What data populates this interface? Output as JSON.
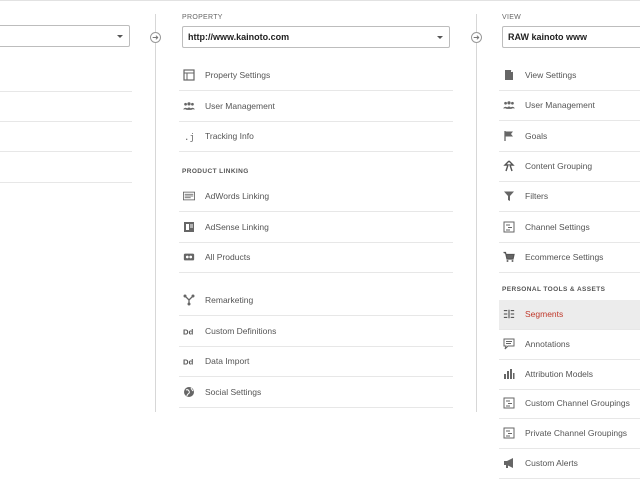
{
  "account": {
    "selected_value": ""
  },
  "property": {
    "label": "PROPERTY",
    "selected_value": "http://www.kainoto.com",
    "items": [
      {
        "label": "Property Settings",
        "icon": "property-settings-icon"
      },
      {
        "label": "User Management",
        "icon": "users-icon"
      },
      {
        "label": "Tracking Info",
        "icon": "js-icon"
      }
    ],
    "product_linking_label": "PRODUCT LINKING",
    "linking_items": [
      {
        "label": "AdWords Linking",
        "icon": "adwords-icon"
      },
      {
        "label": "AdSense Linking",
        "icon": "adsense-icon"
      },
      {
        "label": "All Products",
        "icon": "all-products-icon"
      }
    ],
    "other_items": [
      {
        "label": "Remarketing",
        "icon": "remarketing-icon"
      },
      {
        "label": "Custom Definitions",
        "icon": "dd-icon"
      },
      {
        "label": "Data Import",
        "icon": "dd-icon"
      },
      {
        "label": "Social Settings",
        "icon": "globe-icon"
      }
    ]
  },
  "view": {
    "label": "VIEW",
    "selected_value": "RAW kainoto www",
    "items": [
      {
        "label": "View Settings",
        "icon": "document-icon"
      },
      {
        "label": "User Management",
        "icon": "users-icon"
      },
      {
        "label": "Goals",
        "icon": "flag-icon"
      },
      {
        "label": "Content Grouping",
        "icon": "content-grouping-icon"
      },
      {
        "label": "Filters",
        "icon": "filter-icon"
      },
      {
        "label": "Channel Settings",
        "icon": "channel-icon"
      },
      {
        "label": "Ecommerce Settings",
        "icon": "cart-icon"
      }
    ],
    "personal_label": "PERSONAL TOOLS & ASSETS",
    "personal_items": [
      {
        "label": "Segments",
        "icon": "segments-icon",
        "active": true
      },
      {
        "label": "Annotations",
        "icon": "annotation-icon"
      },
      {
        "label": "Attribution Models",
        "icon": "bar-chart-icon"
      },
      {
        "label": "Custom Channel Groupings",
        "icon": "channel-icon"
      },
      {
        "label": "Private Channel Groupings",
        "icon": "channel-icon"
      },
      {
        "label": "Custom Alerts",
        "icon": "megaphone-icon"
      }
    ]
  },
  "colors": {
    "active_text": "#c0392b",
    "active_bg": "#ececec"
  }
}
